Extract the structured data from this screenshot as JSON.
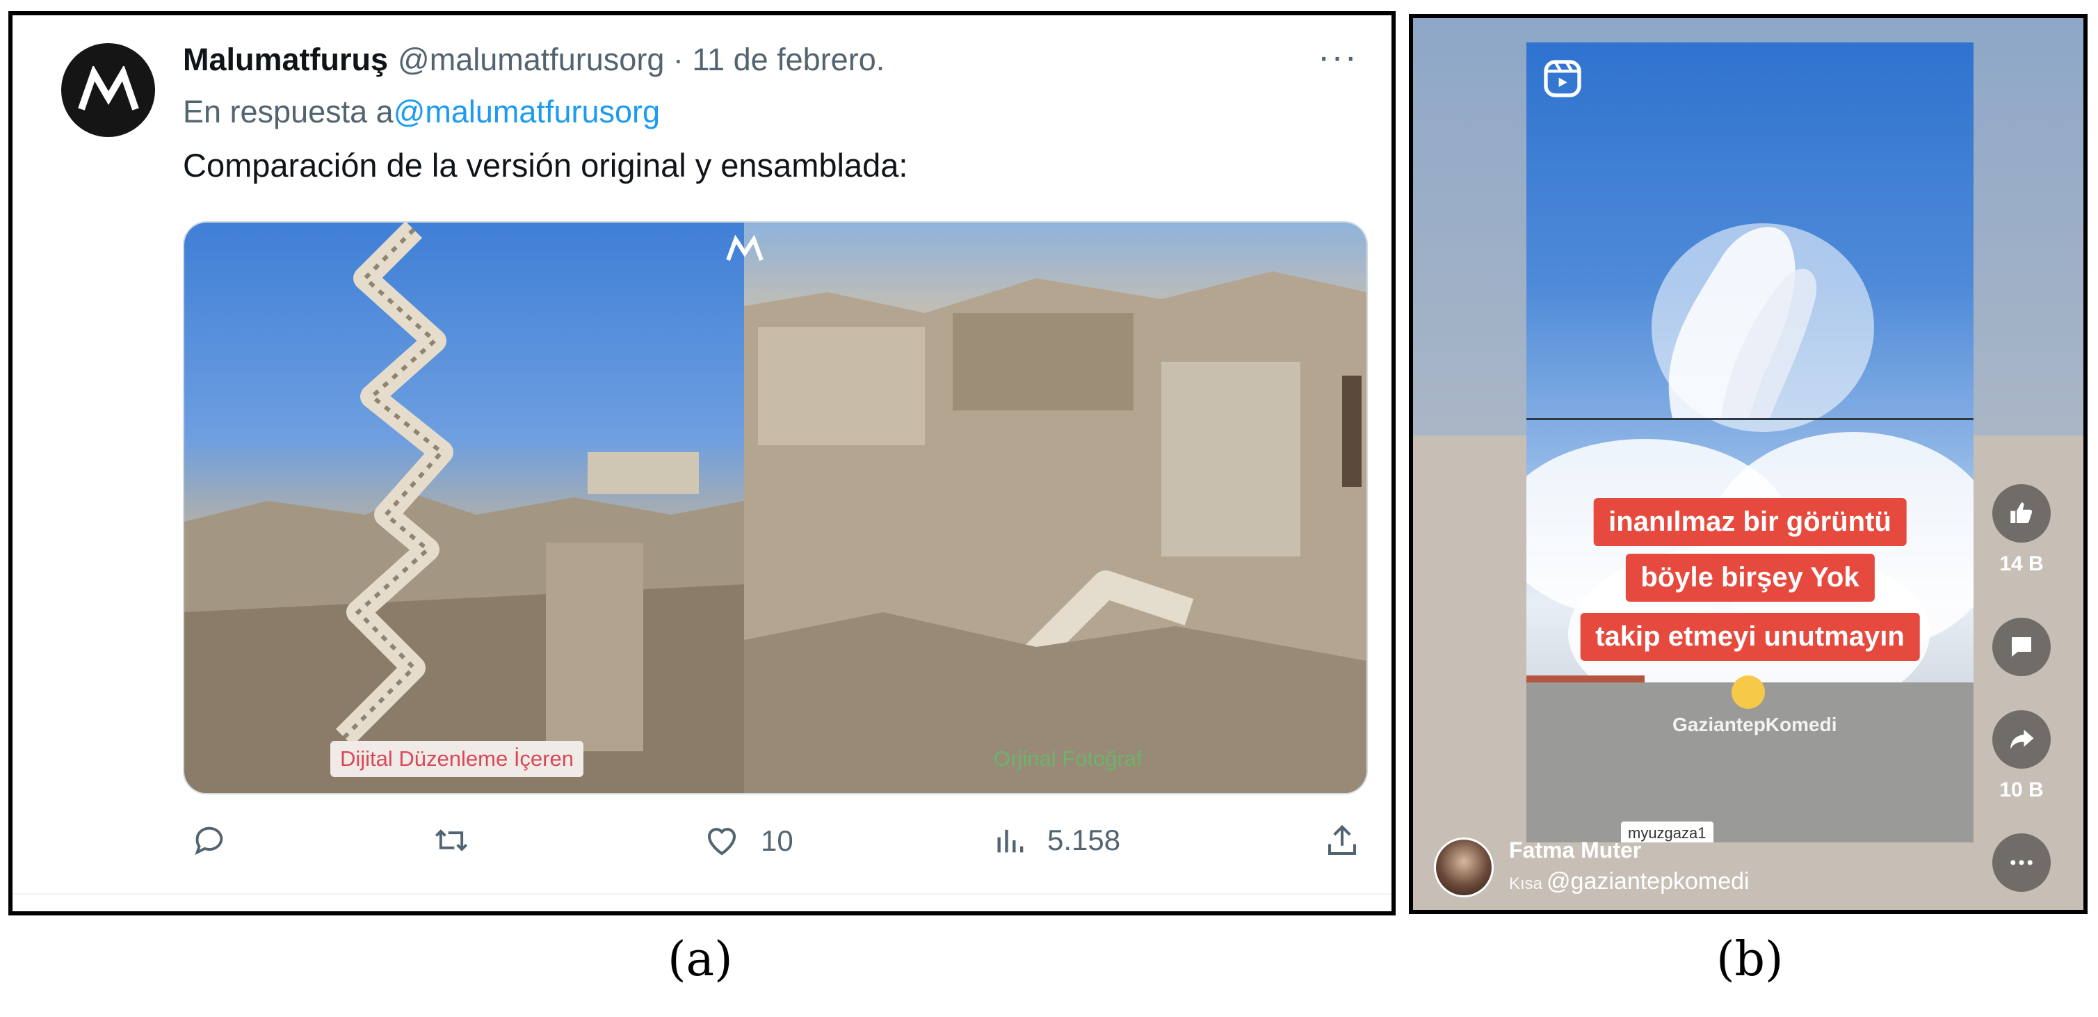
{
  "panel_a": {
    "account_name": "Malumatfuruş",
    "handle": "@malumatfurusorg",
    "date": "· 11 de febrero.",
    "more": "···",
    "reply_prefix": "En respuesta a",
    "reply_handle": "@malumatfurusorg",
    "text": "Comparación de la versión original y ensamblada:",
    "image_label_left": "Dijital Düzenleme İçeren",
    "image_label_right": "Orjinal Fotoğraf",
    "likes": "10",
    "views": "5.158",
    "caption": "(a)"
  },
  "panel_b": {
    "overlay_lines": [
      "inanılmaz bir görüntü",
      "böyle birşey Yok",
      "takip etmeyi unutmayın"
    ],
    "watermark": "GaziantepKomedi",
    "tag": "myuzgaza1",
    "like_count": "14 B",
    "share_count": "10 B",
    "user_name": "Fatma Muter",
    "user_prefix": "Kısa",
    "user_handle": "@gaziantepkomedi",
    "caption": "(b)"
  },
  "colors": {
    "link": "#1d9bf0",
    "overlay_red": "#e6493d",
    "label_red": "#d9485a",
    "label_green": "#6db36a"
  }
}
